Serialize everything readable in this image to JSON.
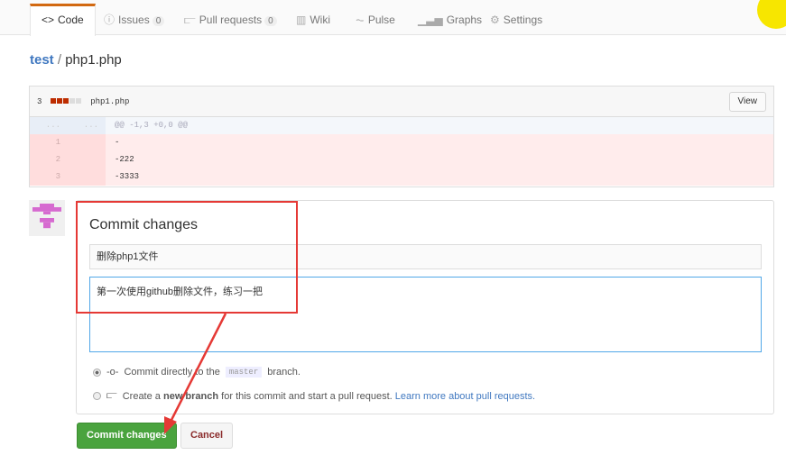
{
  "nav": {
    "tabs": [
      {
        "label": "Code",
        "icon": "code-icon"
      },
      {
        "label": "Issues",
        "count": "0",
        "icon": "issue-icon"
      },
      {
        "label": "Pull requests",
        "count": "0",
        "icon": "pull-request-icon"
      },
      {
        "label": "Wiki",
        "icon": "book-icon"
      },
      {
        "label": "Pulse",
        "icon": "pulse-icon"
      },
      {
        "label": "Graphs",
        "icon": "graph-icon"
      },
      {
        "label": "Settings",
        "icon": "gear-icon"
      }
    ]
  },
  "breadcrumb": {
    "repo": "test",
    "sep": "/",
    "file": "php1.php"
  },
  "diff": {
    "count": "3",
    "filename": "php1.php",
    "view_label": "View",
    "hunk_dots": "...",
    "hunk": "@@ -1,3 +0,0 @@",
    "lines": [
      {
        "n": "1",
        "code": "-"
      },
      {
        "n": "2",
        "code": "-222"
      },
      {
        "n": "3",
        "code": "-3333"
      }
    ]
  },
  "commit": {
    "title": "Commit changes",
    "summary": "删除php1文件",
    "description": "第一次使用github删除文件，练习一把",
    "option1_pre": "Commit directly to the",
    "branch": "master",
    "option1_post": "branch.",
    "option2_pre": "Create a",
    "option2_bold": "new branch",
    "option2_post": "for this commit and start a pull request.",
    "option2_link": "Learn more about pull requests.",
    "submit_label": "Commit changes",
    "cancel_label": "Cancel"
  },
  "colors": {
    "accent": "#d26911",
    "link": "#4078c0",
    "submit": "#4aa33e",
    "annotation": "#e53935"
  }
}
